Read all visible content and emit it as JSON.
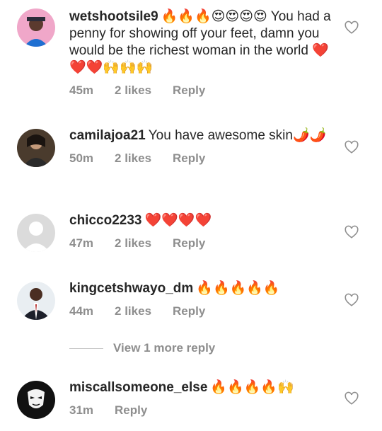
{
  "comments": [
    {
      "username": "wetshootsile9",
      "text": "🔥🔥🔥😍😍😍😍 You had a penny for showing off your feet, damn you would be the richest woman in the world ❤️❤️❤️🙌🙌🙌",
      "time": "45m",
      "likes": "2 likes",
      "reply": "Reply"
    },
    {
      "username": "camilajoa21",
      "text": "You have awesome skin🌶️🌶️",
      "time": "50m",
      "likes": "2 likes",
      "reply": "Reply"
    },
    {
      "username": "chicco2233",
      "text": "❤️❤️❤️❤️",
      "time": "47m",
      "likes": "2 likes",
      "reply": "Reply"
    },
    {
      "username": "kingcetshwayo_dm",
      "text": "🔥🔥🔥🔥🔥",
      "time": "44m",
      "likes": "2 likes",
      "reply": "Reply"
    },
    {
      "username": "miscallsomeone_else",
      "text": "🔥🔥🔥🔥🙌",
      "time": "31m",
      "reply": "Reply"
    }
  ],
  "view_more": "View 1 more reply",
  "icons": {
    "like": "heart-outline-icon"
  },
  "colors": {
    "text": "#262626",
    "meta": "#8e8e8e"
  }
}
